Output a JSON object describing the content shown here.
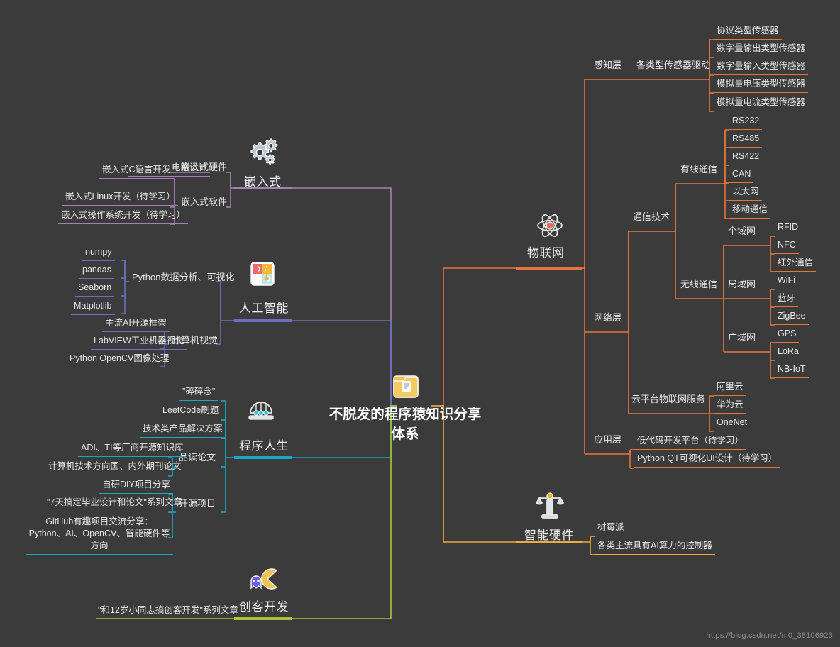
{
  "meta": {
    "background": "#3b3b3b",
    "watermark": "https://blog.csdn.net/m0_38106923"
  },
  "center": {
    "title": "不脱发的程序猿知识分享体系",
    "icon": "folder-icon"
  },
  "colors": {
    "iot": "#e8743b",
    "embedded": "#a77fb5",
    "ai": "#6c6fbf",
    "life": "#17a8c4",
    "hardware": "#f0a93c",
    "maker": "#a8c53a"
  },
  "branches": {
    "iot": {
      "label": "物联网",
      "icon": "atom-icon",
      "color": "#e8743b",
      "children": [
        {
          "label": "感知层",
          "children": [
            {
              "label": "各类型传感器驱动",
              "children": [
                {
                  "label": "协议类型传感器"
                },
                {
                  "label": "数字量输出类型传感器"
                },
                {
                  "label": "数字量输入类型传感器"
                },
                {
                  "label": "模拟量电压类型传感器"
                },
                {
                  "label": "模拟量电流类型传感器"
                }
              ]
            }
          ]
        },
        {
          "label": "网络层",
          "children": [
            {
              "label": "通信技术",
              "children": [
                {
                  "label": "有线通信",
                  "children": [
                    {
                      "label": "RS232"
                    },
                    {
                      "label": "RS485"
                    },
                    {
                      "label": "RS422"
                    },
                    {
                      "label": "CAN"
                    },
                    {
                      "label": "以太网"
                    },
                    {
                      "label": "移动通信"
                    }
                  ]
                },
                {
                  "label": "无线通信",
                  "children": [
                    {
                      "label": "个域网",
                      "children": [
                        {
                          "label": "RFID"
                        },
                        {
                          "label": "NFC"
                        },
                        {
                          "label": "红外通信"
                        }
                      ]
                    },
                    {
                      "label": "局域网",
                      "children": [
                        {
                          "label": "WiFi"
                        },
                        {
                          "label": "蓝牙"
                        },
                        {
                          "label": "ZigBee"
                        }
                      ]
                    },
                    {
                      "label": "广域网",
                      "children": [
                        {
                          "label": "GPS"
                        },
                        {
                          "label": "LoRa"
                        },
                        {
                          "label": "NB-IoT"
                        }
                      ]
                    }
                  ]
                }
              ]
            },
            {
              "label": "云平台物联网服务",
              "children": [
                {
                  "label": "阿里云"
                },
                {
                  "label": "华为云"
                },
                {
                  "label": "OneNet"
                }
              ]
            }
          ]
        },
        {
          "label": "应用层",
          "children": [
            {
              "label": "低代码开发平台（待学习）"
            },
            {
              "label": "Python QT可视化UI设计（待学习）"
            }
          ]
        }
      ]
    },
    "hardware": {
      "label": "智能硬件",
      "icon": "balance-scale-icon",
      "color": "#f0a93c",
      "children": [
        {
          "label": "树莓派"
        },
        {
          "label": "各类主流具有AI算力的控制器"
        }
      ]
    },
    "embedded": {
      "label": "嵌入式",
      "icon": "gears-icon",
      "color": "#a77fb5",
      "children": [
        {
          "label": "嵌入式硬件",
          "children": [
            {
              "label": "电路设计"
            }
          ]
        },
        {
          "label": "嵌入式软件",
          "children": [
            {
              "label": "嵌入式C语言开发"
            },
            {
              "label": "嵌入式Linux开发（待学习）"
            },
            {
              "label": "嵌入式操作系统开发（待学习）"
            }
          ]
        }
      ]
    },
    "ai": {
      "label": "人工智能",
      "icon": "puzzle-icon",
      "color": "#6c6fbf",
      "children": [
        {
          "label": "Python数据分析、可视化",
          "children": [
            {
              "label": "numpy"
            },
            {
              "label": "pandas"
            },
            {
              "label": "Seaborn"
            },
            {
              "label": "Matplotlib"
            }
          ]
        },
        {
          "label": "计算机视觉",
          "children": [
            {
              "label": "主流AI开源框架"
            },
            {
              "label": "LabVIEW工业机器视觉"
            },
            {
              "label": "Python OpenCV图像处理"
            }
          ]
        }
      ]
    },
    "life": {
      "label": "程序人生",
      "icon": "newtons-cradle-icon",
      "color": "#17a8c4",
      "children": [
        {
          "label": "\"碎碎念\""
        },
        {
          "label": "LeetCode刷题"
        },
        {
          "label": "技术类产品解决方案"
        },
        {
          "label": "品读论文",
          "children": [
            {
              "label": "ADI、TI等厂商开源知识库"
            },
            {
              "label": "计算机技术方向国、内外期刊论文"
            }
          ]
        },
        {
          "label": "开源项目",
          "children": [
            {
              "label": "自研DIY项目分享"
            },
            {
              "label": "\"7天搞定毕业设计和论文\"系列文章"
            },
            {
              "label": "GitHub有趣项目交流分享：Python、AI、OpenCV、智能硬件等方向"
            }
          ]
        }
      ]
    },
    "maker": {
      "label": "创客开发",
      "icon": "pacman-icon",
      "color": "#a8c53a",
      "children": [
        {
          "label": "\"和12岁小同志搞创客开发\"系列文章"
        }
      ]
    }
  }
}
